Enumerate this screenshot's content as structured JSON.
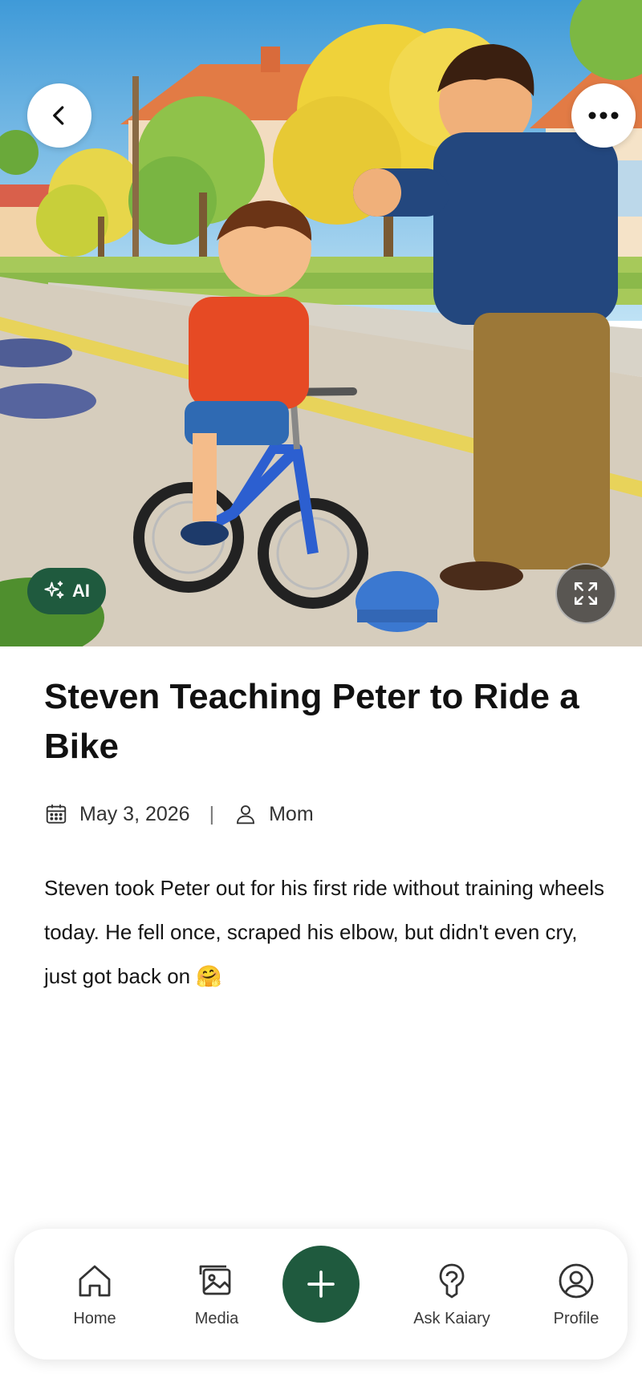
{
  "hero": {
    "image_alt": "Illustration of a man cheering on a boy riding a blue bike",
    "ai_badge_label": "AI"
  },
  "entry": {
    "title": "Steven Teaching Peter to Ride a Bike",
    "date": "May 3, 2026",
    "separator": "|",
    "author": "Mom",
    "body": "Steven took Peter out for his first ride without training wheels today. He fell once, scraped his elbow, but didn't even cry, just got back on 🤗"
  },
  "nav": {
    "items": [
      {
        "label": "Home",
        "icon": "home-icon"
      },
      {
        "label": "Media",
        "icon": "media-icon"
      },
      {
        "label": "",
        "icon": "plus-icon"
      },
      {
        "label": "Ask Kaiary",
        "icon": "ask-icon"
      },
      {
        "label": "Profile",
        "icon": "profile-icon"
      }
    ]
  },
  "colors": {
    "accent": "#1f5a3e",
    "text": "#111111",
    "background": "#ffffff"
  }
}
